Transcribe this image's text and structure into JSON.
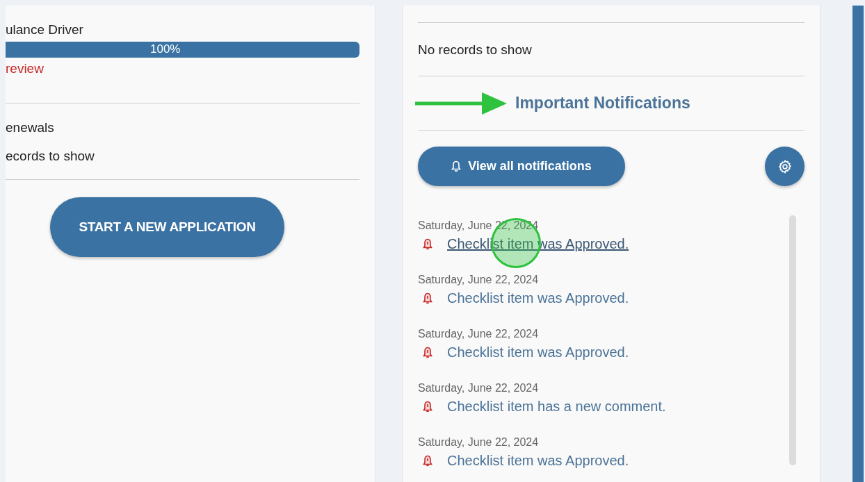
{
  "applications": {
    "title": "ulance Driver",
    "progress": {
      "level": 1,
      "label": "100%"
    },
    "status": "review"
  },
  "renewals": {
    "title": "enewals",
    "empty": "ecords to show"
  },
  "start_button": "START A NEW APPLICATION",
  "records": {
    "empty": "No records to show"
  },
  "notifications": {
    "title": "Important Notifications",
    "view_all": "View all notifications",
    "items": [
      {
        "date": "Saturday, June 22, 2024",
        "text": "Checklist item was Approved.",
        "hovered": true
      },
      {
        "date": "Saturday, June 22, 2024",
        "text": "Checklist item was Approved.",
        "hovered": false
      },
      {
        "date": "Saturday, June 22, 2024",
        "text": "Checklist item was Approved.",
        "hovered": false
      },
      {
        "date": "Saturday, June 22, 2024",
        "text": "Checklist item has a new comment.",
        "hovered": false
      },
      {
        "date": "Saturday, June 22, 2024",
        "text": "Checklist item was Approved.",
        "hovered": false
      }
    ]
  }
}
